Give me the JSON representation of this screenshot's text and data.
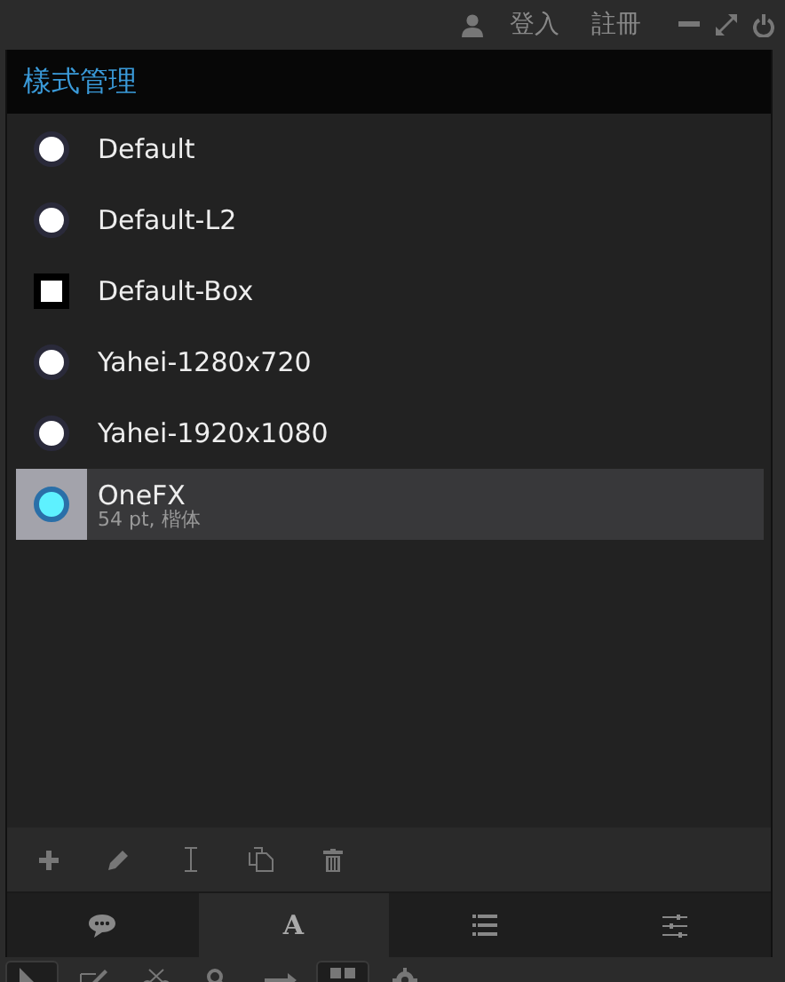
{
  "top_bar": {
    "login": "登入",
    "register": "註冊"
  },
  "panel": {
    "title": "樣式管理"
  },
  "styles": [
    {
      "name": "Default",
      "kind": "circle",
      "selected": false
    },
    {
      "name": "Default-L2",
      "kind": "circle",
      "selected": false
    },
    {
      "name": "Default-Box",
      "kind": "square",
      "selected": false
    },
    {
      "name": "Yahei-1280x720",
      "kind": "circle",
      "selected": false
    },
    {
      "name": "Yahei-1920x1080",
      "kind": "circle",
      "selected": false
    },
    {
      "name": "OneFX",
      "kind": "circle",
      "selected": true,
      "detail": "54 pt, 楷体"
    }
  ],
  "toolbar": [
    {
      "kind": "add"
    },
    {
      "kind": "edit"
    },
    {
      "kind": "rename"
    },
    {
      "kind": "copy"
    },
    {
      "kind": "delete"
    }
  ],
  "tabs": [
    {
      "kind": "comments",
      "selected": false
    },
    {
      "kind": "text",
      "label": "A",
      "selected": true
    },
    {
      "kind": "list",
      "selected": false
    },
    {
      "kind": "settings",
      "selected": false
    }
  ],
  "tools": [
    {
      "kind": "pointer",
      "selected": true
    },
    {
      "kind": "edit",
      "selected": false
    },
    {
      "kind": "cut",
      "selected": false
    },
    {
      "kind": "key",
      "selected": false
    },
    {
      "kind": "arrow",
      "selected": false
    },
    {
      "kind": "grid",
      "selected": true
    },
    {
      "kind": "gear",
      "selected": false
    }
  ]
}
